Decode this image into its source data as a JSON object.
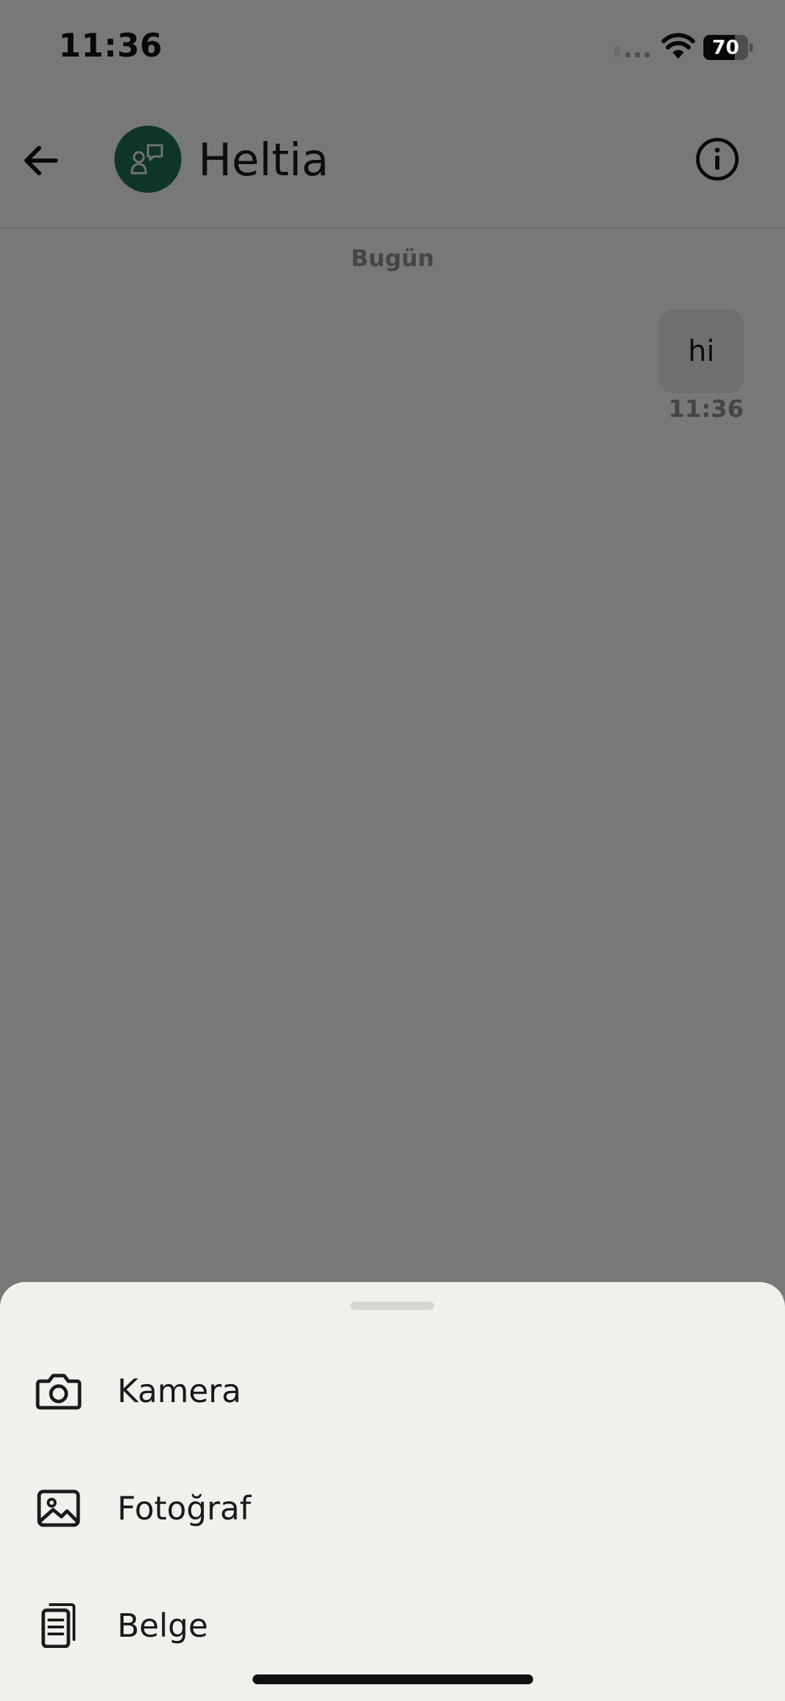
{
  "status_bar": {
    "time": "11:36",
    "battery_level": "70"
  },
  "header": {
    "contact_name": "Heltia"
  },
  "chat": {
    "date_separator": "Bugün",
    "messages": [
      {
        "text": "hi",
        "time": "11:36",
        "direction": "outgoing"
      }
    ]
  },
  "attachment_sheet": {
    "options": [
      {
        "label": "Kamera",
        "icon": "camera-icon"
      },
      {
        "label": "Fotoğraf",
        "icon": "image-icon"
      },
      {
        "label": "Belge",
        "icon": "document-icon"
      }
    ]
  },
  "colors": {
    "avatar_bg": "#1E6B57",
    "sheet_bg": "#F0F0EC",
    "bubble_bg": "#DCE0DC",
    "overlay": "rgba(0,0,0,0.5)"
  }
}
